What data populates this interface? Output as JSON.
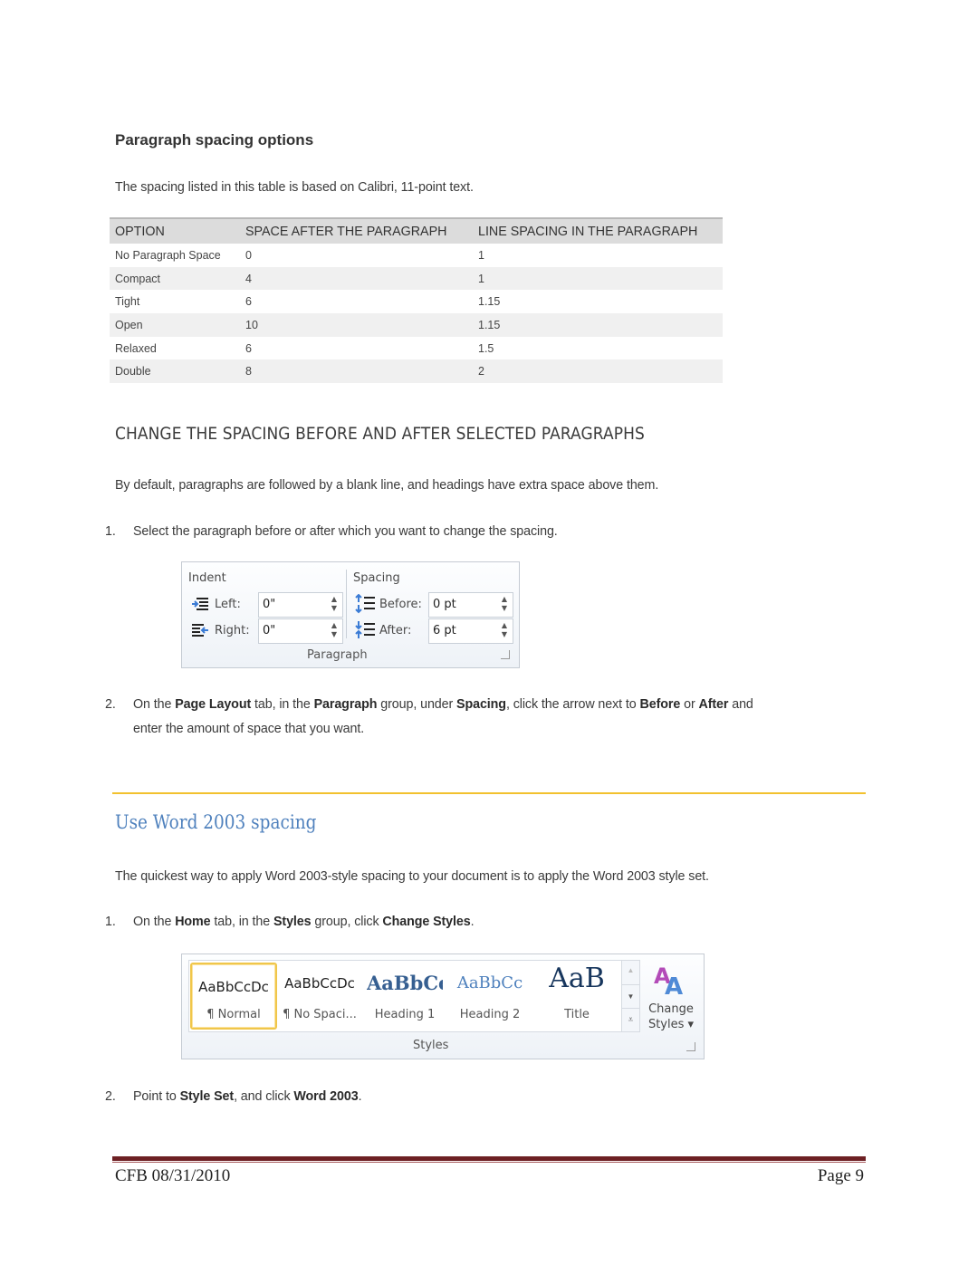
{
  "section1": {
    "heading": "Paragraph spacing options",
    "intro": "The spacing listed in this table is based on Calibri, 11-point text.",
    "table": {
      "headers": [
        "OPTION",
        "SPACE AFTER THE PARAGRAPH",
        "LINE SPACING IN THE PARAGRAPH"
      ],
      "rows": [
        [
          "No Paragraph Space",
          "0",
          "1"
        ],
        [
          "Compact",
          "4",
          "1"
        ],
        [
          "Tight",
          "6",
          "1.15"
        ],
        [
          "Open",
          "10",
          "1.15"
        ],
        [
          "Relaxed",
          "6",
          "1.5"
        ],
        [
          "Double",
          "8",
          "2"
        ]
      ]
    }
  },
  "section2": {
    "heading": "CHANGE THE SPACING BEFORE AND AFTER SELECTED PARAGRAPHS",
    "intro": "By default, paragraphs are followed by a blank line, and headings have extra space above them.",
    "step1": {
      "num": "1.",
      "text": "Select the paragraph before or after which you want to change the spacing."
    },
    "ribbon": {
      "indent_label": "Indent",
      "spacing_label": "Spacing",
      "left_label": "Left:",
      "left_value": "0\"",
      "right_label": "Right:",
      "right_value": "0\"",
      "before_label": "Before:",
      "before_value": "0 pt",
      "after_label": "After:",
      "after_value": "6 pt",
      "group_label": "Paragraph"
    },
    "step2": {
      "num": "2.",
      "t1": "On the ",
      "b1": "Page Layout",
      "t2": " tab, in the ",
      "b2": "Paragraph",
      "t3": " group, under ",
      "b3": "Spacing",
      "t4": ", click the arrow next to ",
      "b4": "Before",
      "t5": " or ",
      "b5": "After",
      "t6": " and",
      "line2": "enter the amount of space that you want."
    }
  },
  "section3": {
    "heading": "Use Word 2003 spacing",
    "intro": "The quickest way to apply Word 2003-style spacing to your document is to apply the Word 2003 style set.",
    "step1": {
      "num": "1.",
      "t1": "On the ",
      "b1": "Home",
      "t2": " tab, in the ",
      "b2": "Styles",
      "t3": " group, click ",
      "b3": "Change Styles",
      "t4": "."
    },
    "styles_ribbon": {
      "tiles": [
        {
          "sample": "AaBbCcDc",
          "name": "¶ Normal"
        },
        {
          "sample": "AaBbCcDc",
          "name": "¶ No Spaci..."
        },
        {
          "sample": "AaBbCс",
          "name": "Heading 1"
        },
        {
          "sample": "AaBbCc",
          "name": "Heading 2"
        },
        {
          "sample": "AaB",
          "name": "Title"
        }
      ],
      "change_styles_line1": "Change",
      "change_styles_line2": "Styles ▾",
      "group_label": "Styles"
    },
    "step2": {
      "num": "2.",
      "t1": "Point to ",
      "b1": "Style Set",
      "t2": ", and click ",
      "b2": "Word 2003",
      "t3": "."
    }
  },
  "footer": {
    "left": "CFB 08/31/2010",
    "right": "Page 9"
  },
  "colors": {
    "heading_blue": "#4f81bd",
    "rule_gold": "#f2c12e",
    "footer_rule": "#6d2024"
  }
}
